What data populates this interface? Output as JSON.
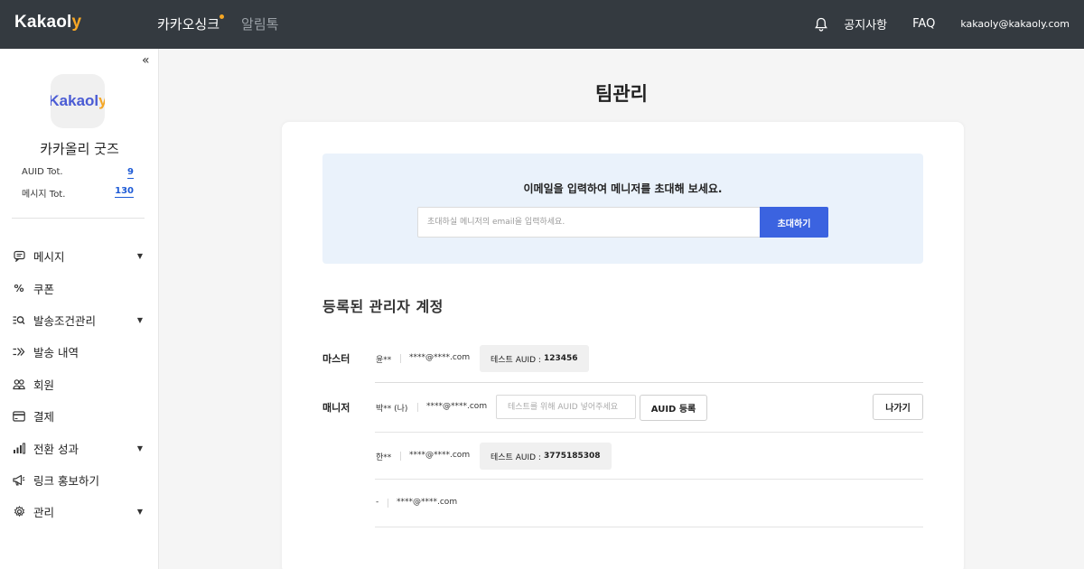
{
  "topbar": {
    "brand_main": "Kakaol",
    "brand_accent": "y",
    "nav": [
      "카카오싱크",
      "알림톡"
    ],
    "notice": "공지사항",
    "faq": "FAQ",
    "email": "kakaoly@kakaoly.com"
  },
  "sidebar": {
    "collapse_glyph": "«",
    "logo_main": "Kakaol",
    "logo_accent": "y",
    "shop_name": "카카올리 굿즈",
    "stats": [
      {
        "label": "AUID Tot.",
        "value": "9"
      },
      {
        "label": "메시지 Tot.",
        "value": "130"
      }
    ],
    "menu": [
      {
        "label": "메시지",
        "icon": "message-icon",
        "caret": true
      },
      {
        "label": "쿠폰",
        "icon": "percent-icon",
        "caret": false
      },
      {
        "label": "발송조건관리",
        "icon": "filter-search-icon",
        "caret": true
      },
      {
        "label": "발송 내역",
        "icon": "send-history-icon",
        "caret": false
      },
      {
        "label": "회원",
        "icon": "users-icon",
        "caret": false
      },
      {
        "label": "결제",
        "icon": "card-icon",
        "caret": false
      },
      {
        "label": "전환 성과",
        "icon": "bar-chart-icon",
        "caret": true
      },
      {
        "label": "링크 홍보하기",
        "icon": "megaphone-icon",
        "caret": false
      },
      {
        "label": "관리",
        "icon": "gear-icon",
        "caret": true
      }
    ]
  },
  "main": {
    "title": "팀관리",
    "invite": {
      "message": "이메일을 입력하여 메니저를 초대해 보세요.",
      "placeholder": "초대하실 메니저의 email을 입력하세요.",
      "button": "초대하기"
    },
    "section_title": "등록된 관리자 계정",
    "master": {
      "label": "마스터",
      "name": "윤**",
      "email": "****@****.com",
      "auid_prefix": "테스트 AUID :",
      "auid": "123456"
    },
    "manager": {
      "label": "매니저",
      "rows": [
        {
          "name": "박** (나)",
          "email": "****@****.com",
          "auid_placeholder": "테스트를 위해 AUID 넣어주세요",
          "register": "AUID 등록",
          "leave": "나가기"
        },
        {
          "name": "한**",
          "email": "****@****.com",
          "auid_prefix": "테스트 AUID :",
          "auid": "3775185308"
        },
        {
          "name": "-",
          "email": "****@****.com"
        }
      ]
    }
  },
  "colors": {
    "topbar": "#343a40",
    "accent": "#f9a825",
    "primary_button": "#3b63e0",
    "invite_bg": "#eaf2fb",
    "link_blue": "#1e5bd6"
  }
}
